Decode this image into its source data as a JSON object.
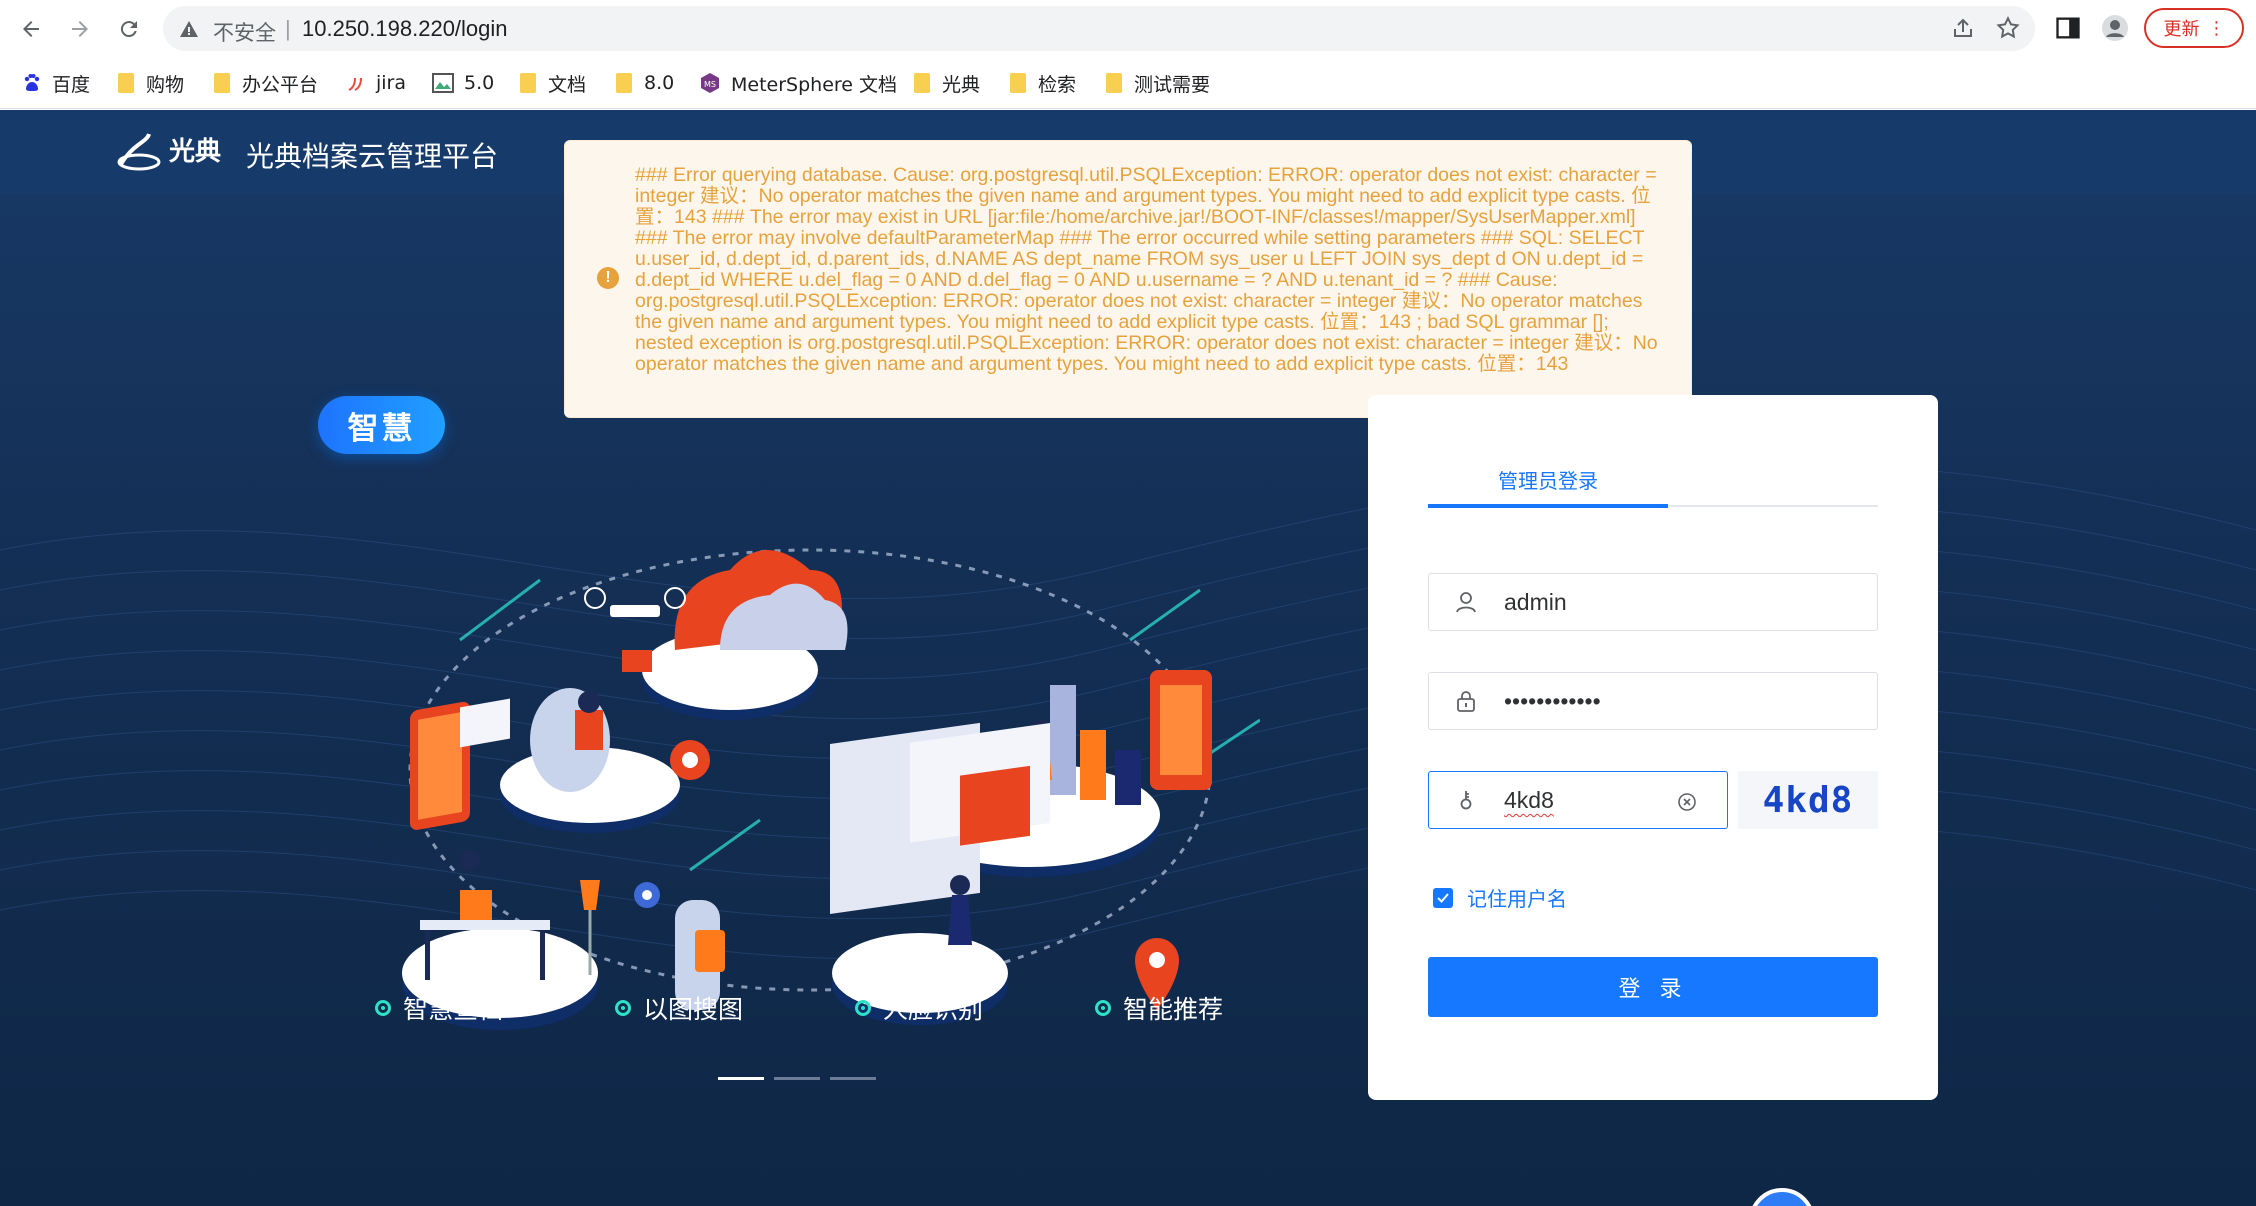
{
  "browser": {
    "security_label": "不安全",
    "separator": "|",
    "url": "10.250.198.220/login",
    "update_label": "更新",
    "update_more": "⋮"
  },
  "bookmarks": [
    {
      "label": "百度",
      "icon": "baidu-paw-icon"
    },
    {
      "label": "购物",
      "icon": "folder-icon"
    },
    {
      "label": "办公平台",
      "icon": "folder-icon"
    },
    {
      "label": "jira",
      "icon": "jira-icon"
    },
    {
      "label": "5.0",
      "icon": "image-icon"
    },
    {
      "label": "文档",
      "icon": "folder-icon"
    },
    {
      "label": "8.0",
      "icon": "folder-icon"
    },
    {
      "label": "MeterSphere 文档",
      "icon": "metersphere-icon"
    },
    {
      "label": "光典",
      "icon": "folder-icon"
    },
    {
      "label": "检索",
      "icon": "folder-icon"
    },
    {
      "label": "测试需要",
      "icon": "folder-icon"
    }
  ],
  "header": {
    "logo_text": "光典",
    "title": "光典档案云管理平台"
  },
  "error": {
    "icon": "!",
    "message": "### Error querying database. Cause: org.postgresql.util.PSQLException: ERROR: operator does not exist: character = integer 建议：No operator matches the given name and argument types. You might need to add explicit type casts. 位置：143 ### The error may exist in URL [jar:file:/home/archive.jar!/BOOT-INF/classes!/mapper/SysUserMapper.xml] ### The error may involve defaultParameterMap ### The error occurred while setting parameters ### SQL: SELECT u.user_id, d.dept_id, d.parent_ids, d.NAME AS dept_name FROM sys_user u LEFT JOIN sys_dept d ON u.dept_id = d.dept_id WHERE u.del_flag = 0 AND d.del_flag = 0 AND u.username = ? AND u.tenant_id = ? ### Cause: org.postgresql.util.PSQLException: ERROR: operator does not exist: character = integer 建议：No operator matches the given name and argument types. You might need to add explicit type casts. 位置：143 ; bad SQL grammar []; nested exception is org.postgresql.util.PSQLException: ERROR: operator does not exist: character = integer 建议：No operator matches the given name and argument types. You might need to add explicit type casts. 位置：143",
    "color": "#e6a23c"
  },
  "hero": {
    "badge": "智慧",
    "features": [
      "智慧查档",
      "以图搜图",
      "人脸识别",
      "智能推荐"
    ],
    "carousel_active": 1
  },
  "login": {
    "tab_label": "管理员登录",
    "username_value": "admin",
    "password_value": "••••••••••••",
    "captcha_value": "4kd8",
    "captcha_image_text": "4kd8",
    "remember_label": "记住用户名",
    "remember_checked": true,
    "submit_label": "登 录",
    "accent": "#1677ff"
  }
}
